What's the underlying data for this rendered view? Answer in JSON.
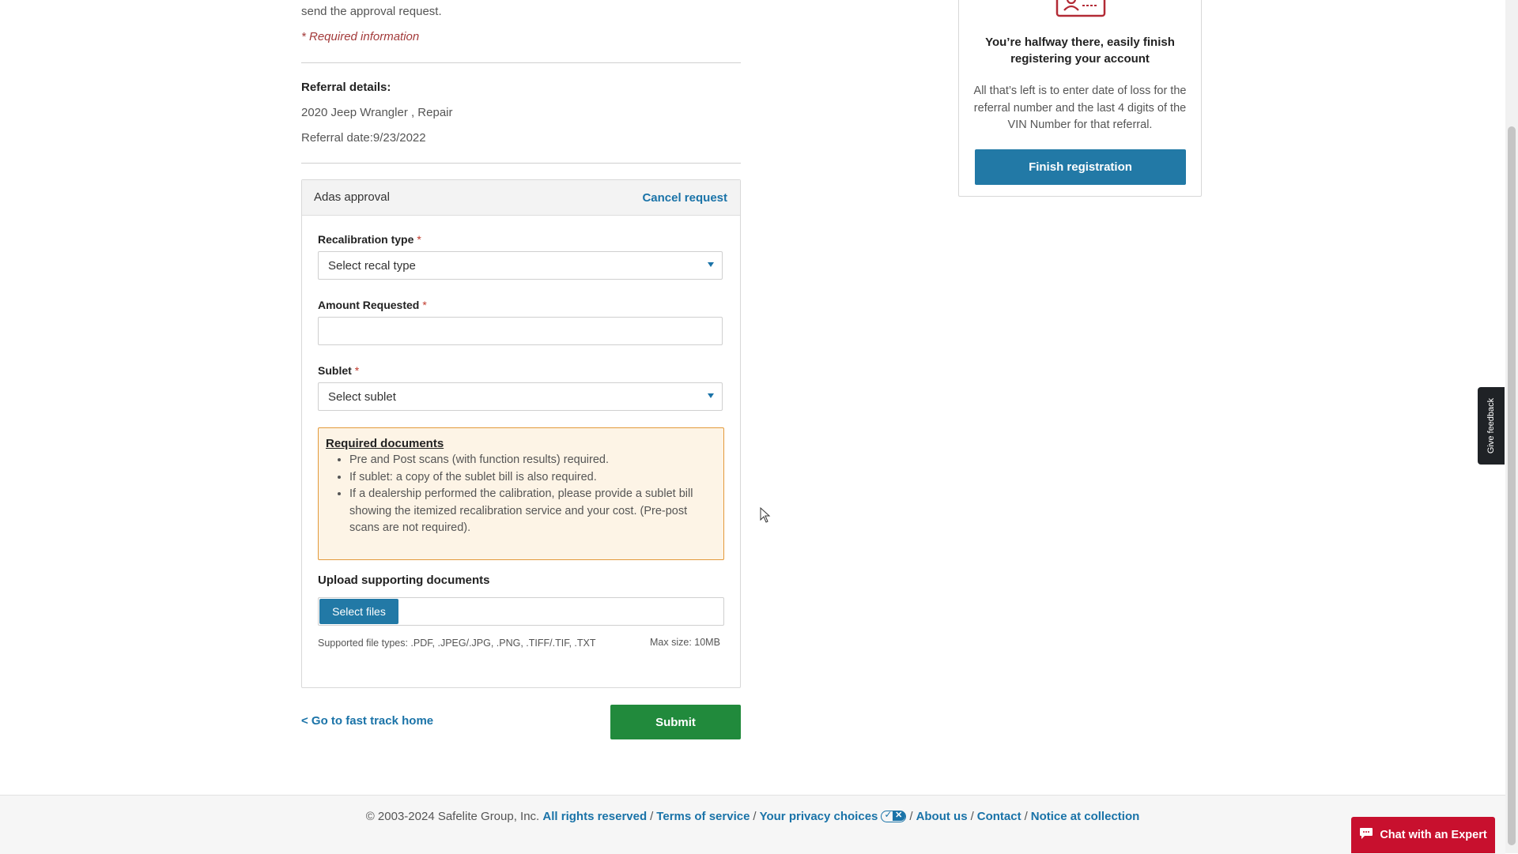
{
  "intro": {
    "text": "send the approval request.",
    "required_info": "* Required information"
  },
  "referral": {
    "title": "Referral details:",
    "vehicle": "2020 Jeep Wrangler , Repair",
    "date": "Referral date:9/23/2022"
  },
  "panel": {
    "title": "Adas approval",
    "cancel_label": "Cancel request",
    "recal": {
      "label": "Recalibration type",
      "star": "*",
      "value": "Select recal type"
    },
    "amount": {
      "label": "Amount Requested",
      "star": "*",
      "value": ""
    },
    "sublet": {
      "label": "Sublet",
      "star": "*",
      "value": "Select sublet"
    },
    "docs": {
      "title": "Required documents",
      "items": [
        "Pre and Post scans (with function results) required.",
        "If sublet: a copy of the sublet bill is also required.",
        "If a dealership performed the calibration, please provide a sublet bill showing the itemized recalibration service and your cost. (Pre-post scans are not required)."
      ]
    },
    "upload": {
      "label": "Upload supporting documents",
      "button": "Select files",
      "file_types": "Supported file types: .PDF, .JPEG/.JPG, .PNG, .TIFF/.TIF, .TXT",
      "max_size": "Max size: 10MB"
    }
  },
  "actions": {
    "back_link": "< Go to fast track home",
    "submit": "Submit"
  },
  "card": {
    "icon": "id-card-icon",
    "title": "You’re halfway there, easily finish registering your account",
    "text": "All that’s left is to enter date of loss for the referral number and the last 4 digits of the VIN Number for that referral.",
    "button": "Finish registration"
  },
  "feedback": {
    "label": "Give feedback"
  },
  "footer": {
    "copyright": "© 2003-2024 Safelite Group, Inc.",
    "links": [
      "All rights reserved",
      "Terms of service",
      "Your privacy choices",
      "About us",
      "Contact",
      "Notice at collection"
    ]
  },
  "chat": {
    "label": "Chat with an Expert",
    "icon": "chat-bubble-icon"
  },
  "colors": {
    "link": "#1a73a8",
    "primary_button": "#2279a6",
    "submit": "#218a3c",
    "chat": "#c8102e",
    "required_star": "#c0392b",
    "docs_border": "#e39a3b"
  }
}
